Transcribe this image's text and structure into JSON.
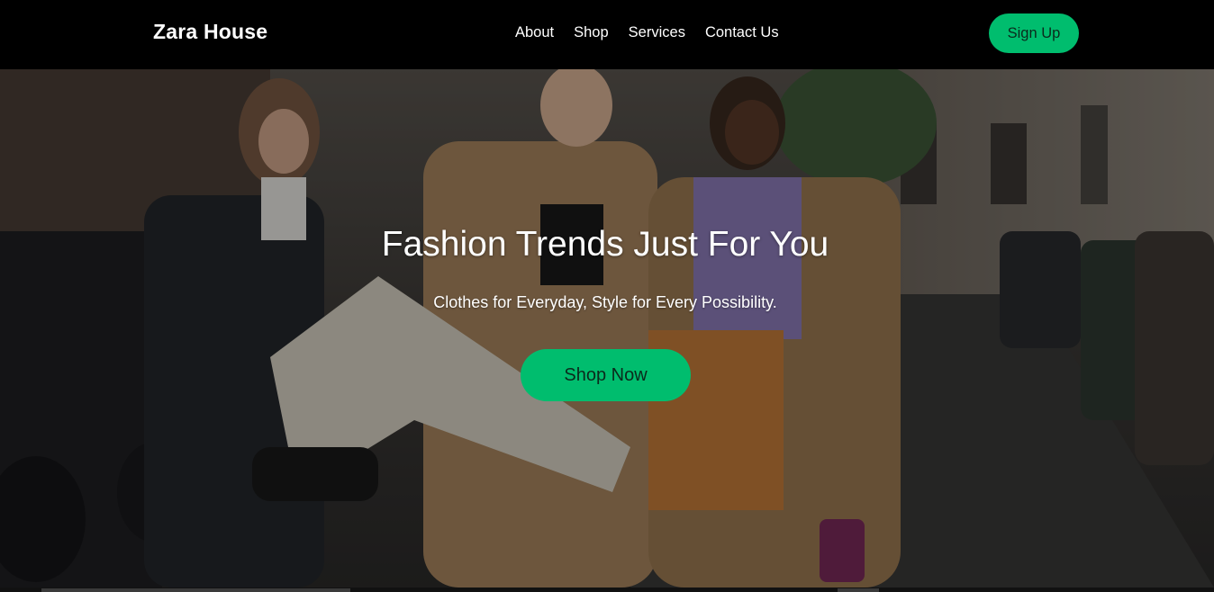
{
  "nav": {
    "brand": "Zara House",
    "links": [
      {
        "label": "About"
      },
      {
        "label": "Shop"
      },
      {
        "label": "Services"
      },
      {
        "label": "Contact Us"
      }
    ],
    "signup_label": "Sign Up"
  },
  "hero": {
    "title": "Fashion Trends Just For You",
    "subtitle": "Clothes for Everyday, Style for Every Possibility.",
    "cta_label": "Shop Now",
    "background_image": "street-style-fashion-photo"
  },
  "colors": {
    "accent": "#00bd6e",
    "nav_bg": "#000000",
    "text": "#ffffff"
  }
}
